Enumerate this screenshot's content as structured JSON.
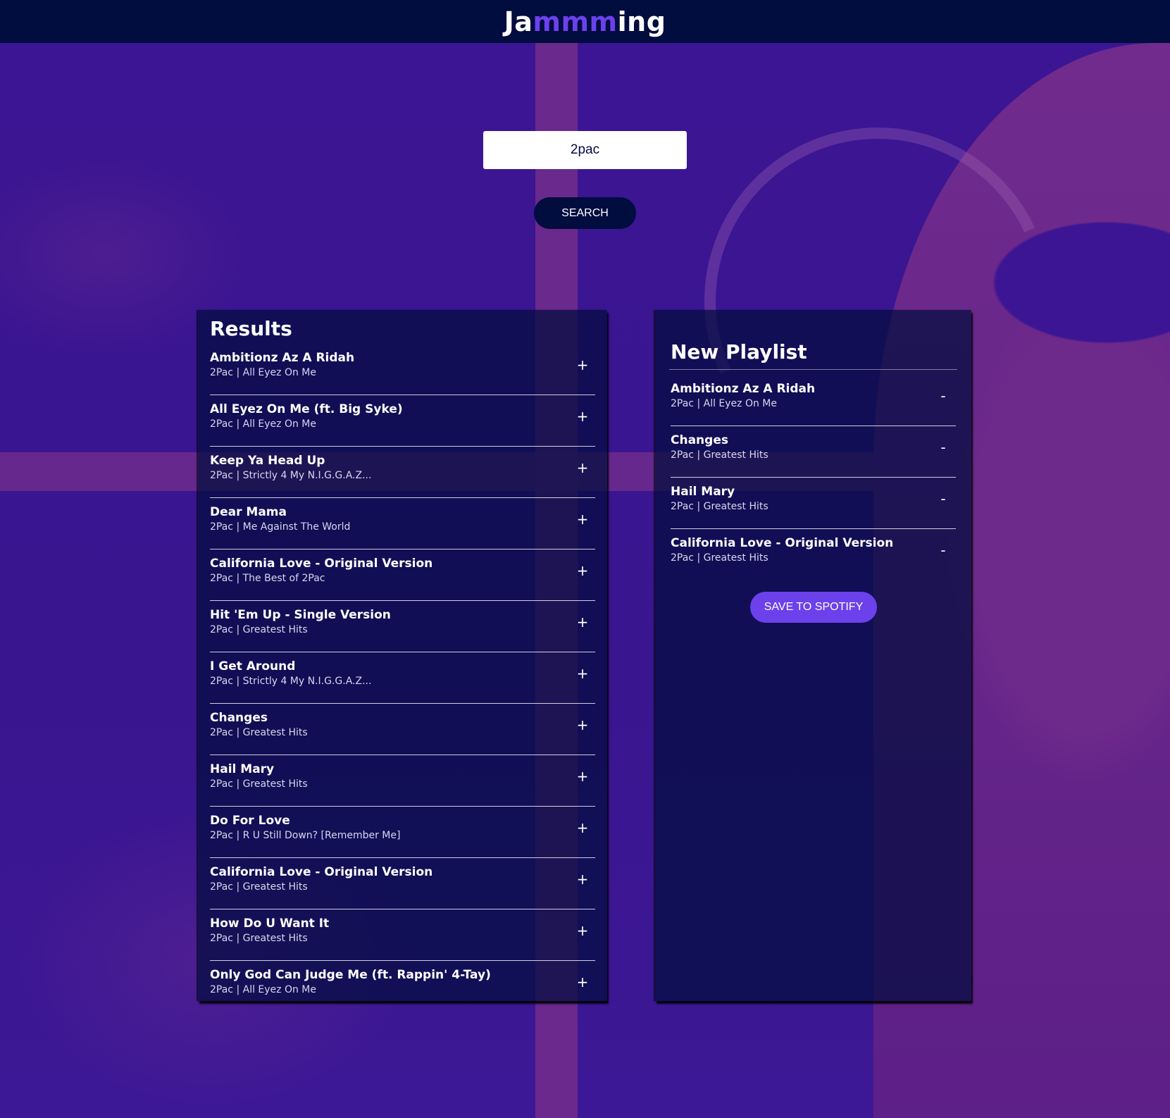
{
  "header": {
    "logo_prefix": "Ja",
    "logo_accent": "mmm",
    "logo_suffix": "ing",
    "accent_color": "#6c41ec",
    "bg_color": "#010c3f"
  },
  "search": {
    "value": "2pac",
    "button_label": "SEARCH"
  },
  "results": {
    "title": "Results",
    "action_icon": "+",
    "tracks": [
      {
        "name": "Ambitionz Az A Ridah",
        "artist": "2Pac",
        "album": "All Eyez On Me",
        "info": "2Pac | All Eyez On Me"
      },
      {
        "name": "All Eyez On Me (ft. Big Syke)",
        "artist": "2Pac",
        "album": "All Eyez On Me",
        "info": "2Pac | All Eyez On Me"
      },
      {
        "name": "Keep Ya Head Up",
        "artist": "2Pac",
        "album": "Strictly 4 My N.I.G.G.A.Z...",
        "info": "2Pac | Strictly 4 My N.I.G.G.A.Z..."
      },
      {
        "name": "Dear Mama",
        "artist": "2Pac",
        "album": "Me Against The World",
        "info": "2Pac | Me Against The World"
      },
      {
        "name": "California Love - Original Version",
        "artist": "2Pac",
        "album": "The Best of 2Pac",
        "info": "2Pac | The Best of 2Pac"
      },
      {
        "name": "Hit 'Em Up - Single Version",
        "artist": "2Pac",
        "album": "Greatest Hits",
        "info": "2Pac | Greatest Hits"
      },
      {
        "name": "I Get Around",
        "artist": "2Pac",
        "album": "Strictly 4 My N.I.G.G.A.Z...",
        "info": "2Pac | Strictly 4 My N.I.G.G.A.Z..."
      },
      {
        "name": "Changes",
        "artist": "2Pac",
        "album": "Greatest Hits",
        "info": "2Pac | Greatest Hits"
      },
      {
        "name": "Hail Mary",
        "artist": "2Pac",
        "album": "Greatest Hits",
        "info": "2Pac | Greatest Hits"
      },
      {
        "name": "Do For Love",
        "artist": "2Pac",
        "album": "R U Still Down? [Remember Me]",
        "info": "2Pac | R U Still Down? [Remember Me]"
      },
      {
        "name": "California Love - Original Version",
        "artist": "2Pac",
        "album": "Greatest Hits",
        "info": "2Pac | Greatest Hits"
      },
      {
        "name": "How Do U Want It",
        "artist": "2Pac",
        "album": "Greatest Hits",
        "info": "2Pac | Greatest Hits"
      },
      {
        "name": "Only God Can Judge Me (ft. Rappin' 4-Tay)",
        "artist": "2Pac",
        "album": "All Eyez On Me",
        "info": "2Pac | All Eyez On Me"
      }
    ]
  },
  "playlist": {
    "title": "New Playlist",
    "action_icon": "-",
    "save_label": "SAVE TO SPOTIFY",
    "save_color": "#6c41ec",
    "tracks": [
      {
        "name": "Ambitionz Az A Ridah",
        "artist": "2Pac",
        "album": "All Eyez On Me",
        "info": "2Pac | All Eyez On Me"
      },
      {
        "name": "Changes",
        "artist": "2Pac",
        "album": "Greatest Hits",
        "info": "2Pac | Greatest Hits"
      },
      {
        "name": "Hail Mary",
        "artist": "2Pac",
        "album": "Greatest Hits",
        "info": "2Pac | Greatest Hits"
      },
      {
        "name": "California Love - Original Version",
        "artist": "2Pac",
        "album": "Greatest Hits",
        "info": "2Pac | Greatest Hits"
      }
    ]
  }
}
